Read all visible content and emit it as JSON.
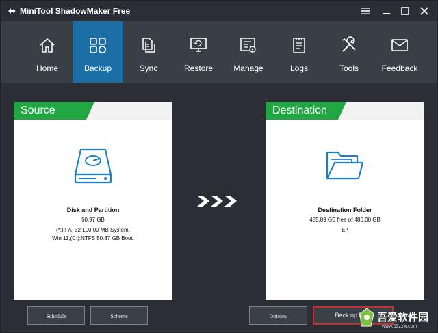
{
  "window": {
    "title": "MiniTool ShadowMaker Free"
  },
  "nav": {
    "items": [
      {
        "label": "Home",
        "icon": "home-icon"
      },
      {
        "label": "Backup",
        "icon": "backup-icon"
      },
      {
        "label": "Sync",
        "icon": "sync-icon"
      },
      {
        "label": "Restore",
        "icon": "restore-icon"
      },
      {
        "label": "Manage",
        "icon": "manage-icon"
      },
      {
        "label": "Logs",
        "icon": "logs-icon"
      },
      {
        "label": "Tools",
        "icon": "tools-icon"
      },
      {
        "label": "Feedback",
        "icon": "feedback-icon"
      }
    ],
    "active": "Backup"
  },
  "source": {
    "header": "Source",
    "title": "Disk and Partition",
    "size": "50.97 GB",
    "line1": "(*:):FAT32 100.00 MB System.",
    "line2": "Win 11,(C:):NTFS 50.87 GB Boot."
  },
  "destination": {
    "header": "Destination",
    "title": "Destination Folder",
    "free": "485.89 GB free of 486.00 GB",
    "path": "E:\\"
  },
  "buttons": {
    "schedule": "Schedule",
    "scheme": "Scheme",
    "options": "Options",
    "backup_now": "Back up Now"
  },
  "watermark": {
    "text": "吾爱软件园",
    "url": "www.52zxw.com"
  },
  "colors": {
    "accent_green": "#21a644",
    "active_blue": "#1b6fa6",
    "icon_blue": "#1e7fc2",
    "highlight_red": "#d32a2a"
  }
}
